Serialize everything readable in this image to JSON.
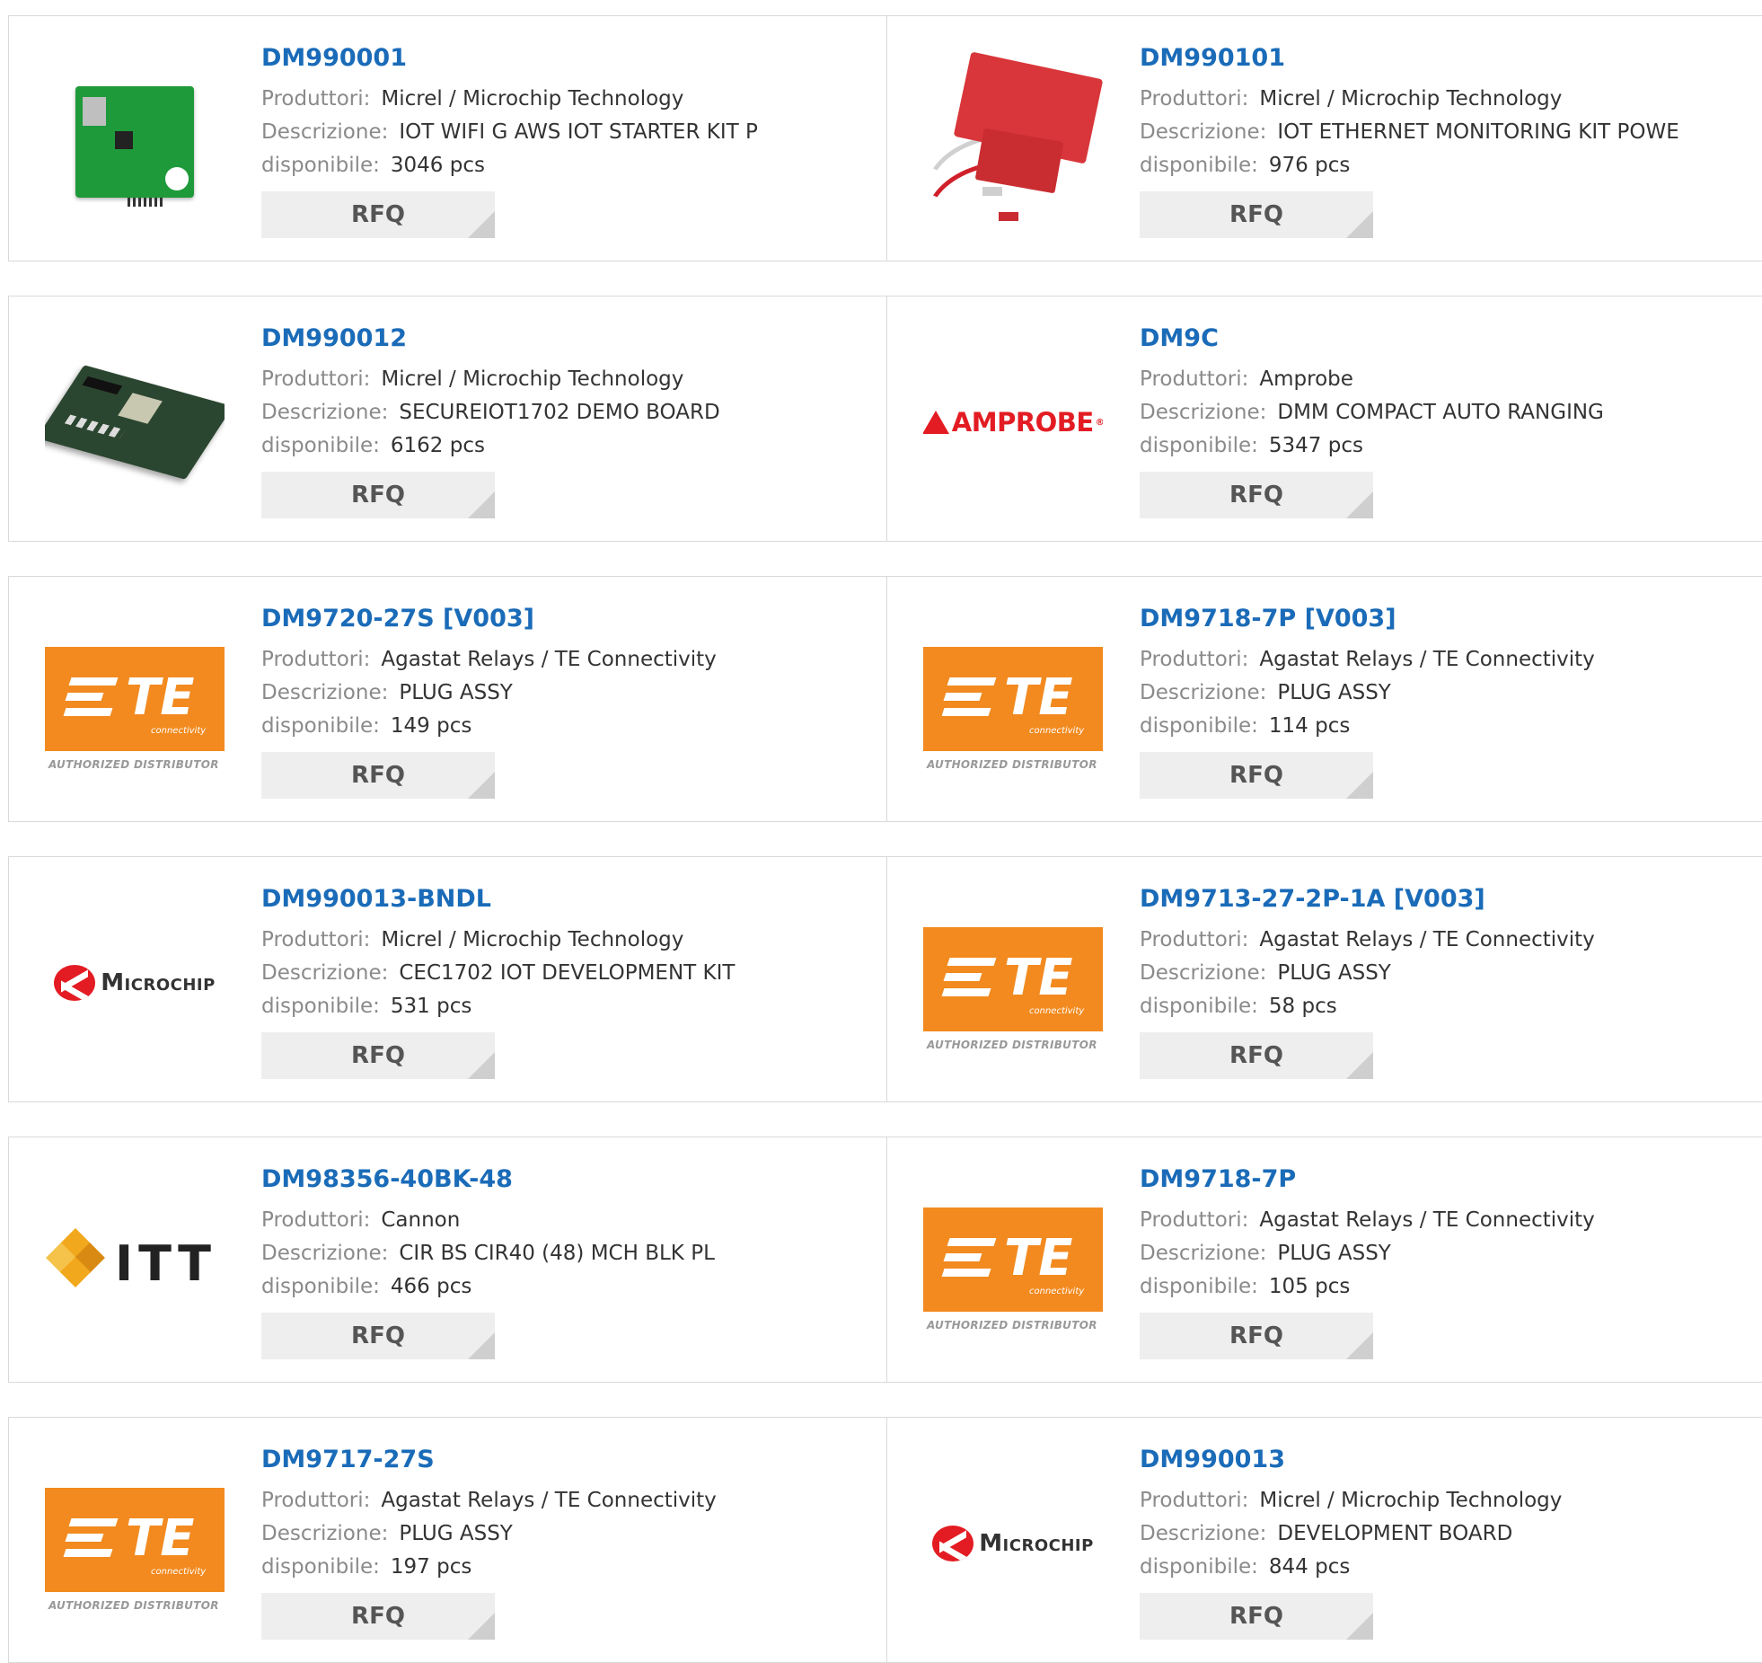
{
  "labels": {
    "manufacturer": "Produttori:",
    "description": "Descrizione:",
    "available": "disponibile:",
    "rfq": "RFQ"
  },
  "te_logo": {
    "letters": "TE",
    "sub": "connectivity",
    "authorized": "AUTHORIZED DISTRIBUTOR"
  },
  "amprobe_logo": {
    "word": "AMPROBE"
  },
  "microchip_logo": {
    "word": "Microchip"
  },
  "itt_logo": {
    "word": "ITT"
  },
  "products": [
    {
      "pn": "DM990001",
      "manufacturer": "Micrel / Microchip Technology",
      "description": "IOT WIFI G AWS IOT STARTER KIT P",
      "available": "3046 pcs",
      "image": "green-pcb"
    },
    {
      "pn": "DM990101",
      "manufacturer": "Micrel / Microchip Technology",
      "description": "IOT ETHERNET MONITORING KIT POWE",
      "available": "976 pcs",
      "image": "red-kit"
    },
    {
      "pn": "DM990012",
      "manufacturer": "Micrel / Microchip Technology",
      "description": "SECUREIOT1702 DEMO BOARD",
      "available": "6162 pcs",
      "image": "demo-board"
    },
    {
      "pn": "DM9C",
      "manufacturer": "Amprobe",
      "description": "DMM COMPACT AUTO RANGING",
      "available": "5347 pcs",
      "image": "amprobe-logo"
    },
    {
      "pn": "DM9720-27S [V003]",
      "manufacturer": "Agastat Relays / TE Connectivity",
      "description": "PLUG ASSY",
      "available": "149 pcs",
      "image": "te-logo"
    },
    {
      "pn": "DM9718-7P [V003]",
      "manufacturer": "Agastat Relays / TE Connectivity",
      "description": "PLUG ASSY",
      "available": "114 pcs",
      "image": "te-logo"
    },
    {
      "pn": "DM990013-BNDL",
      "manufacturer": "Micrel / Microchip Technology",
      "description": "CEC1702 IOT DEVELOPMENT KIT",
      "available": "531 pcs",
      "image": "microchip-logo"
    },
    {
      "pn": "DM9713-27-2P-1A [V003]",
      "manufacturer": "Agastat Relays / TE Connectivity",
      "description": "PLUG ASSY",
      "available": "58 pcs",
      "image": "te-logo"
    },
    {
      "pn": "DM98356-40BK-48",
      "manufacturer": "Cannon",
      "description": "CIR BS CIR40 (48) MCH BLK PL",
      "available": "466 pcs",
      "image": "itt-logo"
    },
    {
      "pn": "DM9718-7P",
      "manufacturer": "Agastat Relays / TE Connectivity",
      "description": "PLUG ASSY",
      "available": "105 pcs",
      "image": "te-logo"
    },
    {
      "pn": "DM9717-27S",
      "manufacturer": "Agastat Relays / TE Connectivity",
      "description": "PLUG ASSY",
      "available": "197 pcs",
      "image": "te-logo"
    },
    {
      "pn": "DM990013",
      "manufacturer": "Micrel / Microchip Technology",
      "description": "DEVELOPMENT BOARD",
      "available": "844 pcs",
      "image": "microchip-logo"
    }
  ],
  "colors": {
    "link": "#1a6bb8",
    "te_orange": "#f28a1f",
    "amprobe_red": "#e31c23",
    "microchip_red": "#e31c23"
  }
}
